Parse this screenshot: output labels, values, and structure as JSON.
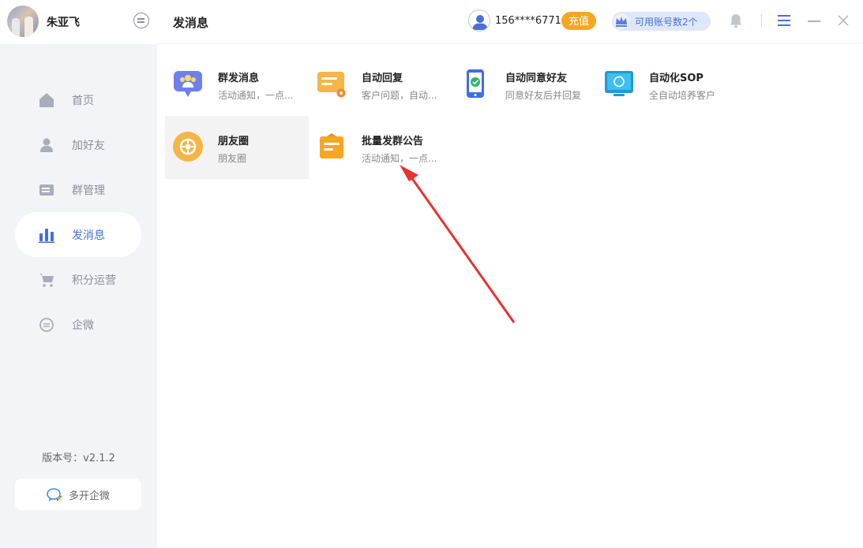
{
  "profile": {
    "name": "朱亚飞"
  },
  "sidebar": {
    "items": [
      {
        "label": "首页",
        "icon": "home-icon"
      },
      {
        "label": "加好友",
        "icon": "user-icon"
      },
      {
        "label": "群管理",
        "icon": "group-manage-icon"
      },
      {
        "label": "发消息",
        "icon": "bar-chart-icon",
        "active": true
      },
      {
        "label": "积分运营",
        "icon": "cart-icon"
      },
      {
        "label": "企微",
        "icon": "chat-icon"
      }
    ],
    "version": "版本号：v2.1.2",
    "multi_open": "多开企微"
  },
  "header": {
    "title": "发消息",
    "phone": "156****6771",
    "recharge": "充值",
    "account_badge": "可用账号数2个"
  },
  "cards": [
    {
      "title": "群发消息",
      "desc": "活动通知，一点...",
      "icon": "group-message-icon"
    },
    {
      "title": "自动回复",
      "desc": "客户问题，自动...",
      "icon": "auto-reply-icon"
    },
    {
      "title": "自动同意好友",
      "desc": "同意好友后并回复",
      "icon": "phone-check-icon"
    },
    {
      "title": "自动化SOP",
      "desc": "全自动培养客户",
      "icon": "monitor-sop-icon"
    },
    {
      "title": "朋友圈",
      "desc": "朋友圈",
      "icon": "moments-icon"
    },
    {
      "title": "批量发群公告",
      "desc": "活动通知，一点...",
      "icon": "announcement-icon"
    }
  ],
  "colors": {
    "accent": "#3f6ee8",
    "orange": "#f5a623",
    "arrow": "#e8322c",
    "sidebar_bg": "#f3f4f8"
  }
}
